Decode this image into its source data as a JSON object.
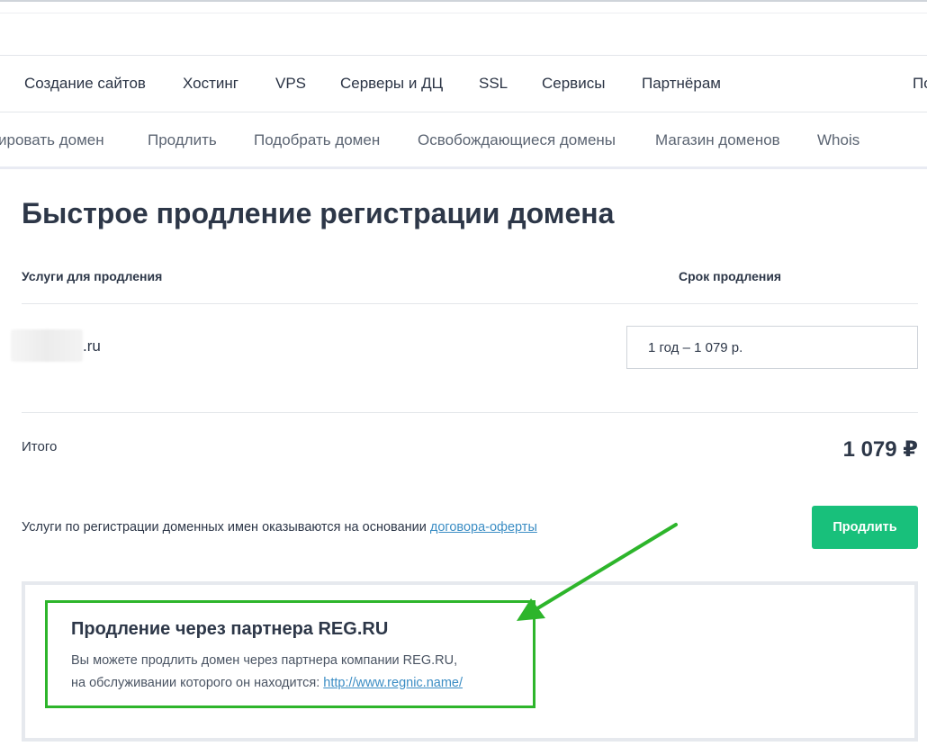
{
  "main_nav": [
    {
      "label": "Создание сайтов"
    },
    {
      "label": "Хостинг"
    },
    {
      "label": "VPS"
    },
    {
      "label": "Серверы и ДЦ"
    },
    {
      "label": "SSL"
    },
    {
      "label": "Сервисы"
    },
    {
      "label": "Партнёрам"
    },
    {
      "label": "По"
    }
  ],
  "sub_nav": [
    {
      "label": "ировать домен"
    },
    {
      "label": "Продлить"
    },
    {
      "label": "Подобрать домен"
    },
    {
      "label": "Освобождающиеся домены"
    },
    {
      "label": "Магазин доменов"
    },
    {
      "label": "Whois"
    }
  ],
  "page_title": "Быстрое продление регистрации домена",
  "table": {
    "col_services": "Услуги для продления",
    "col_term": "Срок продления",
    "domain_suffix": ".ru",
    "term_value": "1 год – 1 079 р."
  },
  "total": {
    "label": "Итого",
    "value": "1 079 ₽"
  },
  "offer": {
    "text": "Услуги по регистрации доменных имен оказываются на основании ",
    "link": "договора-оферты"
  },
  "renew_button": "Продлить",
  "partner": {
    "title": "Продление через партнера REG.RU",
    "line1": "Вы можете продлить домен через партнера компании REG.RU,",
    "line2_prefix": "на обслуживании которого он находится: ",
    "link": "http://www.regnic.name/"
  },
  "colors": {
    "accent_green": "#18c07b",
    "highlight_green": "#2db52b",
    "link_blue": "#3b8dc4"
  }
}
